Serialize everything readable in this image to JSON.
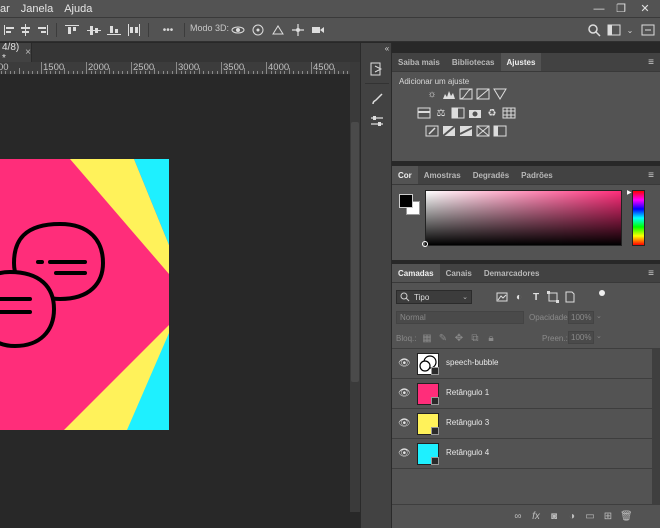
{
  "menu": {
    "items": [
      "ar",
      "Janela",
      "Ajuda"
    ]
  },
  "options_bar": {
    "mode_3d_label": "Modo 3D:",
    "more_label": "•••"
  },
  "document": {
    "tab_title": "4/8) *",
    "close_glyph": "×"
  },
  "ruler": {
    "labels": [
      "00",
      "1500",
      "2000",
      "2500",
      "3000",
      "3500",
      "4000",
      "4500"
    ]
  },
  "adjust_panel": {
    "tabs": [
      "Saiba mais",
      "Bibliotecas",
      "Ajustes"
    ],
    "active_tab": "Ajustes",
    "add_adjustment_label": "Adicionar um ajuste"
  },
  "color_panel": {
    "tabs": [
      "Cor",
      "Amostras",
      "Degradês",
      "Padrões"
    ],
    "active_tab": "Cor",
    "foreground": "#000000",
    "background": "#ffffff",
    "hue_color": "#ff3c8e"
  },
  "layers_panel": {
    "tabs": [
      "Camadas",
      "Canais",
      "Demarcadores"
    ],
    "active_tab": "Camadas",
    "filter_label": "Tipo",
    "blend_mode": "Normal",
    "opacity_label": "Opacidade:",
    "opacity_value": "100%",
    "lock_label": "Bloq.:",
    "fill_label": "Preen.:",
    "fill_value": "100%",
    "layers": [
      {
        "name": "speech-bubble",
        "thumb_color": "#ffffff",
        "type": "smart"
      },
      {
        "name": "Retângulo 1",
        "thumb_color": "#ff2d7a",
        "type": "shape"
      },
      {
        "name": "Retângulo 3",
        "thumb_color": "#fff25a",
        "type": "shape"
      },
      {
        "name": "Retângulo 4",
        "thumb_color": "#1ef0ff",
        "type": "shape"
      }
    ],
    "footer_icons": [
      "link-icon",
      "fx-icon",
      "mask-icon",
      "adjustment-icon",
      "group-icon",
      "new-layer-icon",
      "trash-icon"
    ],
    "fx_label": "fx"
  },
  "colors": {
    "artwork_pink": "#ff2d7a",
    "artwork_yellow": "#fff25a",
    "artwork_cyan": "#1ef0ff",
    "ui_dark": "#282828",
    "ui_panel": "#535353"
  }
}
